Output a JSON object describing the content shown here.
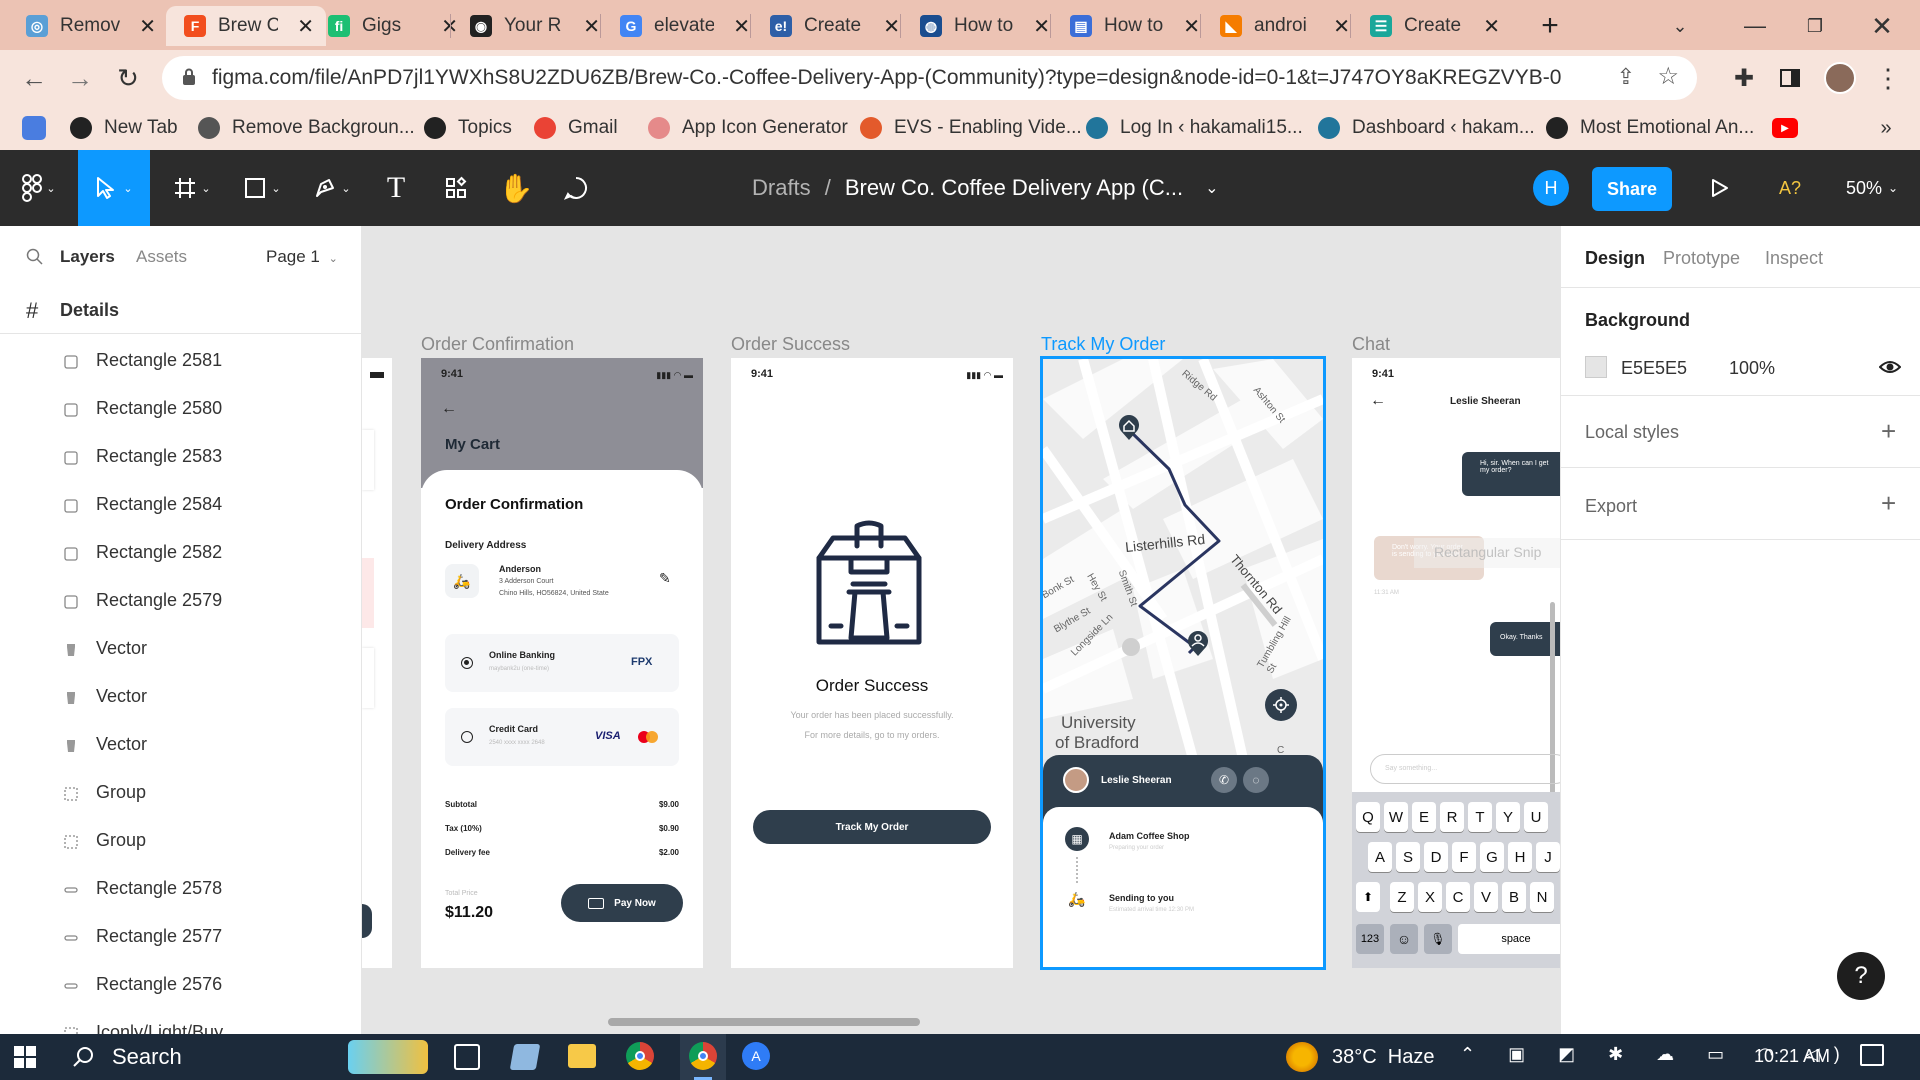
{
  "browser": {
    "tabs": [
      {
        "label": "Remov",
        "color": "#5a9fd6",
        "glyph": "◎"
      },
      {
        "label": "Brew C",
        "color": "#f24e1e",
        "glyph": "F"
      },
      {
        "label": "Gigs",
        "color": "#1dbf73",
        "glyph": "fi"
      },
      {
        "label": "Your R",
        "color": "#222222",
        "glyph": "◉"
      },
      {
        "label": "elevate",
        "color": "#4285f4",
        "glyph": "G"
      },
      {
        "label": "Create",
        "color": "#2e5fa7",
        "glyph": "e!"
      },
      {
        "label": "How to",
        "color": "#1a4d8f",
        "glyph": "◍"
      },
      {
        "label": "How to",
        "color": "#3b6ed8",
        "glyph": "▤"
      },
      {
        "label": "androi",
        "color": "#f57c00",
        "glyph": "◣"
      },
      {
        "label": "Create",
        "color": "#1aa79a",
        "glyph": "☰"
      }
    ],
    "url": "figma.com/file/AnPD7jl1YWXhS8U2ZDU6ZB/Brew-Co.-Coffee-Delivery-App-(Community)?type=design&node-id=0-1&t=J747OY8aKREGZVYB-0",
    "bookmarks": [
      {
        "label": "New Tab",
        "color": "#222222"
      },
      {
        "label": "Remove Backgroun...",
        "color": "#555555"
      },
      {
        "label": "Topics",
        "color": "#222222"
      },
      {
        "label": "Gmail",
        "color": "#ea4335"
      },
      {
        "label": "App Icon Generator",
        "color": "#e58a8a"
      },
      {
        "label": "EVS - Enabling Vide...",
        "color": "#e35a2b"
      },
      {
        "label": "Log In ‹ hakamali15...",
        "color": "#21759b"
      },
      {
        "label": "Dashboard ‹ hakam...",
        "color": "#21759b"
      },
      {
        "label": "Most Emotional An...",
        "color": "#222222"
      }
    ]
  },
  "toolbar": {
    "breadcrumb_root": "Drafts",
    "separator": "/",
    "file_name": "Brew Co. Coffee Delivery App (C...",
    "avatar_initial": "H",
    "share_label": "Share",
    "accessibility_label": "A?",
    "zoom": "50%",
    "accent": "#0d99ff"
  },
  "left_panel": {
    "tabs": {
      "layers": "Layers",
      "assets": "Assets",
      "page": "Page 1"
    },
    "frame_title": "Details",
    "layers": [
      {
        "name": "Rectangle 2581",
        "icon": "rect"
      },
      {
        "name": "Rectangle 2580",
        "icon": "rect"
      },
      {
        "name": "Rectangle 2583",
        "icon": "rect"
      },
      {
        "name": "Rectangle 2584",
        "icon": "rect"
      },
      {
        "name": "Rectangle 2582",
        "icon": "rect"
      },
      {
        "name": "Rectangle 2579",
        "icon": "rect"
      },
      {
        "name": "Vector",
        "icon": "vector"
      },
      {
        "name": "Vector",
        "icon": "vector"
      },
      {
        "name": "Vector",
        "icon": "vector"
      },
      {
        "name": "Group",
        "icon": "group"
      },
      {
        "name": "Group",
        "icon": "group"
      },
      {
        "name": "Rectangle 2578",
        "icon": "line"
      },
      {
        "name": "Rectangle 2577",
        "icon": "line"
      },
      {
        "name": "Rectangle 2576",
        "icon": "line"
      },
      {
        "name": "Iconly/Light/Buy",
        "icon": "group"
      }
    ]
  },
  "frames": {
    "labels": {
      "confirmation": "Order Confirmation",
      "success": "Order Success",
      "track": "Track My Order",
      "chat": "Chat"
    },
    "time": "9:41",
    "confirmation": {
      "header": "My Cart",
      "title": "Order Confirmation",
      "delivery_label": "Delivery Address",
      "name": "Anderson",
      "address1": "3 Adderson Court",
      "address2": "Chino Hills, HO56824, United State",
      "pay1_title": "Online Banking",
      "pay1_sub": "maybank2u (one-time)",
      "pay1_brand": "FPX",
      "pay2_title": "Credit Card",
      "pay2_sub": "2540 xxxx xxxx 2648",
      "pay2_brand": "VISA",
      "subtotal_label": "Subtotal",
      "subtotal": "$9.00",
      "tax_label": "Tax (10%)",
      "tax": "$0.90",
      "fee_label": "Delivery fee",
      "fee": "$2.00",
      "total_label": "Total Price",
      "total": "$11.20",
      "pay_button": "Pay Now"
    },
    "success": {
      "title": "Order Success",
      "line1": "Your order has been placed successfully.",
      "line2": "For more details, go to my orders.",
      "button": "Track My Order"
    },
    "track": {
      "streets": [
        "Listerhills Rd",
        "Thornton Rd",
        "Smith St",
        "Hey St",
        "Longside Ln",
        "Blythe St",
        "Bonk St",
        "Tumbling Hill St",
        "Ashton St",
        "Ridge Rd",
        "University",
        "of Bradford"
      ],
      "courier": "Leslie Sheeran",
      "step1": "Adam Coffee Shop",
      "step1_sub": "Preparing your order",
      "step2": "Sending to you",
      "step2_sub": "Estimated arrival time 12:30 PM"
    },
    "chat": {
      "contact": "Leslie Sheeran",
      "msg1": "Hi, sir. When can I get my order?",
      "msg2": "Don't worry. Your order is sending to you now.",
      "msg2_time": "11:31 AM",
      "msg3": "Okay. Thanks",
      "input_placeholder": "Say something...",
      "snip_overlay": "Rectangular Snip",
      "kb_row1": [
        "Q",
        "W",
        "E",
        "R",
        "T",
        "Y",
        "U"
      ],
      "kb_row2": [
        "A",
        "S",
        "D",
        "F",
        "G",
        "H",
        "J"
      ],
      "kb_row3": [
        "Z",
        "X",
        "C",
        "V",
        "B",
        "N"
      ],
      "kb_num": "123",
      "kb_space": "space"
    }
  },
  "right_panel": {
    "tabs": {
      "design": "Design",
      "prototype": "Prototype",
      "inspect": "Inspect"
    },
    "background_label": "Background",
    "bg_hex": "E5E5E5",
    "bg_opacity": "100%",
    "local_styles": "Local styles",
    "export": "Export",
    "help": "?"
  },
  "taskbar": {
    "search": "Search",
    "weather": "38°C  Haze",
    "time": "10:21 AM"
  }
}
